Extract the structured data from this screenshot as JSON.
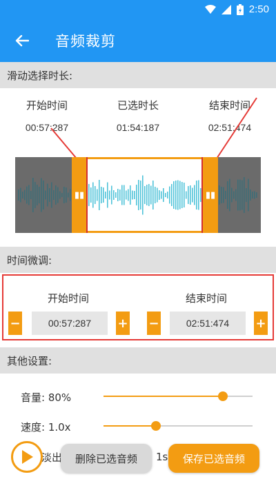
{
  "status_bar": {
    "time": "2:50",
    "icons": [
      "wifi-icon",
      "signal-icon",
      "battery-icon"
    ]
  },
  "app_bar": {
    "title": "音频裁剪",
    "back_icon": "arrow-left-icon"
  },
  "sections": {
    "slide_select": "滑动选择时长:",
    "fine_tune": "时间微调:",
    "other_settings": "其他设置:"
  },
  "summary": {
    "start_label": "开始时间",
    "start_value": "00:57:287",
    "selected_label": "已选时长",
    "selected_value": "01:54:187",
    "end_label": "结束时间",
    "end_value": "02:51:474"
  },
  "fine_tune": {
    "start_label": "开始时间",
    "start_value": "00:57:287",
    "end_label": "结束时间",
    "end_value": "02:51:474"
  },
  "settings": {
    "volume_label": "音量: 80%",
    "volume_level": 0.8,
    "speed_label": "速度: 1.0x",
    "speed_level": 0.35,
    "fade_label": "淡入淡出",
    "fade_value": "1s"
  },
  "buttons": {
    "delete": "删除已选音频",
    "save": "保存已选音频"
  },
  "colors": {
    "primary": "#2196f3",
    "accent": "#f39c12",
    "highlight": "#e53935",
    "waveform_bg": "#6b6b6b",
    "wave_selected": "#4fc3d9",
    "wave_unselected": "#3d6e78"
  }
}
